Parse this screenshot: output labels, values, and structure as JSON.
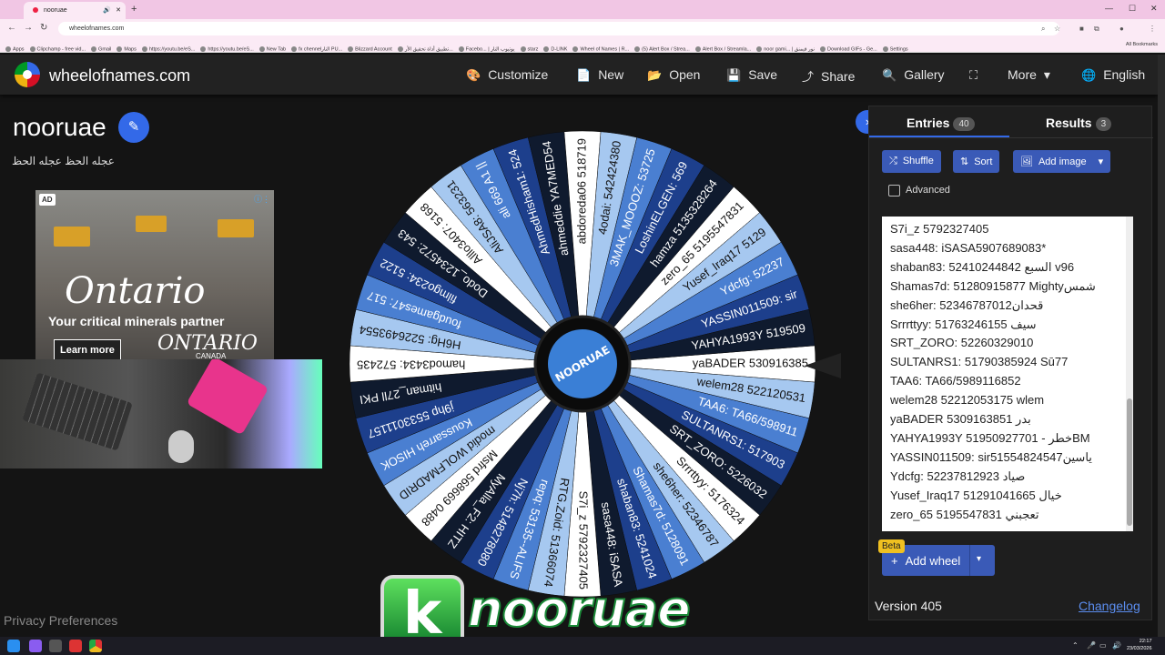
{
  "browser": {
    "tab_title": "nooruae",
    "new_tab_symbol": "+",
    "url": "wheelofnames.com",
    "bookmarks": [
      "Apps",
      "Clipchamp - free vid...",
      "Gmail",
      "Maps",
      "https://youtu.be/eS...",
      "https://youtu.be/eS...",
      "New Tab",
      "fx chennelالنار PU...",
      "Blizzard Account",
      "تطبيق أداة تحقيق الأر...",
      "Facebo... | يوتيوب النار",
      "starz",
      "D-LINK",
      "Wheel of Names | R...",
      "(5) Alert Box / Strea...",
      "Alert Box / Streamla...",
      "noor gami... | نور قيمنق",
      "Download GIFs - Ge...",
      "Settings"
    ],
    "all_bookmarks": "All Bookmarks"
  },
  "header": {
    "site_name": "wheelofnames.com",
    "nav": [
      {
        "icon": "palette-icon",
        "glyph": "🎨",
        "label": "Customize"
      },
      {
        "icon": "new-file-icon",
        "glyph": "📄",
        "label": "New"
      },
      {
        "icon": "folder-icon",
        "glyph": "📂",
        "label": "Open"
      },
      {
        "icon": "save-icon",
        "glyph": "💾",
        "label": "Save"
      },
      {
        "icon": "share-icon",
        "glyph": "⤴",
        "label": "Share"
      },
      {
        "icon": "search-icon",
        "glyph": "🔍",
        "label": "Gallery"
      },
      {
        "icon": "fullscreen-icon",
        "glyph": "⛶",
        "label": ""
      },
      {
        "icon": "chevron-down-icon",
        "glyph": "▾",
        "label": "More"
      },
      {
        "icon": "globe-icon",
        "glyph": "🌐",
        "label": "English"
      }
    ]
  },
  "wheel_info": {
    "title": "nooruae",
    "description": "عجله الحظ عجله الحظ"
  },
  "ad": {
    "badge": "AD",
    "brand": "Ontario",
    "tagline": "Your critical minerals partner",
    "cta": "Learn more",
    "logo_text": "ONTARIO",
    "logo_sub": "CANADA"
  },
  "wheel": {
    "hub_text": "NOORUAE",
    "colors": [
      "#ffffff",
      "#a6c8f0",
      "#4a7fd1",
      "#1d3f8c",
      "#0f1a2e"
    ],
    "slices": [
      "yaBADER 530916385",
      "welem28 522120531",
      "TAA6: TA66/598911",
      "SULTANRS1: 517903",
      "SRT_ZORO: 5226032",
      "Srrrttyy: 5176324",
      "she6her: 52346787",
      "Shamas7d: 5128091",
      "shaban83: 5241024",
      "sasa448: iSASA",
      "S7i_z 5792327405",
      "RTG.Zoid: 51366074",
      "repq: 53135--ALIFS",
      "Nj7h: 5148278080",
      "MyAlla_F2: HITZ",
      "Msfrd 568669 0488",
      "modid WOLFMADRID",
      "Koussarreh HISOK",
      "j9hp 5533011157",
      "hitman_27ll PKI",
      "hamod3434: 572435",
      "H6Hg: 5226493554",
      "foudgames47: 517",
      "filmgo234: 5122",
      "Dodo_1234572: 543",
      "Alllo3407: 5168",
      "AliJSA8: 563231",
      "ali 669 A1 ||",
      "AhmedHisham1: 524",
      "ahmeddie YA7MED54",
      "abdoreda06 518719",
      "4odai: 542424380",
      "3MAK_MOOOZ: 53725",
      "LoshinELGEN: 569",
      "hamza 5135328264",
      "zero_65 5195547831",
      "Yusef_Iraq17 5129",
      "Ydcfg: 52237",
      "YASSIN011509: sir",
      "YAHYA1993Y 519509"
    ]
  },
  "banner": {
    "letter": "k",
    "text": "nooruae"
  },
  "panel": {
    "entries_tab": "Entries",
    "entries_count": "40",
    "results_tab": "Results",
    "results_count": "3",
    "shuffle": "Shuffle",
    "sort": "Sort",
    "add_image": "Add image",
    "advanced": "Advanced",
    "entries": [
      "S7i_z 5792327405",
      "sasa448: iSASA5907689083*",
      "shaban83: 52410244842 السبع v96",
      "Shamas7d: 51280915877 Mightyشمس",
      "she6her: 52346787012قحدان",
      "Srrrttyy: 51763246155 سيف",
      "SRT_ZORO: 52260329010",
      "SULTANRS1: 51790385924 Sū77",
      "TAA6: TA66/5989116852",
      "welem28 52212053175 wlem",
      "yaBADER 5309163851 بدر",
      "YAHYA1993Y 51950927701 - خطرBM",
      "YASSIN011509: sir51554824547ياسين",
      "Ydcfg: 52237812923 صياد",
      "Yusef_Iraq17 51291041665 خيال",
      "zero_65 5195547831 تعجبني"
    ],
    "beta": "Beta",
    "add_wheel": "Add wheel",
    "version": "Version 405",
    "changelog": "Changelog"
  },
  "privacy": "Privacy Preferences",
  "taskbar": {
    "time": "22:17",
    "date": "23/03/2026"
  }
}
